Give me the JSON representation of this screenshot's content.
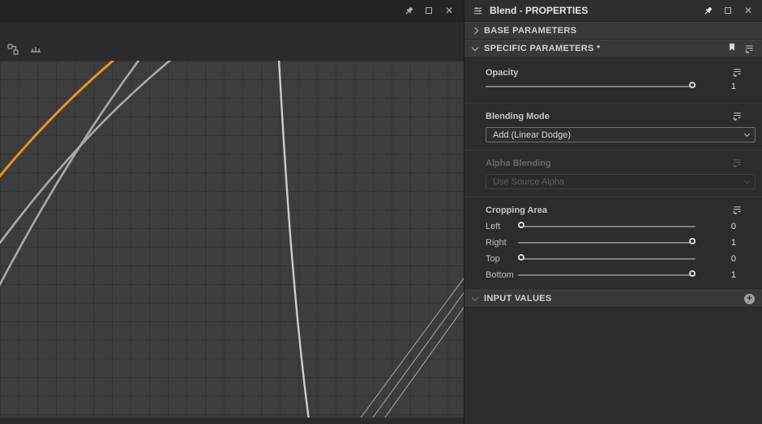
{
  "icons": {
    "close": "✕",
    "add": "+"
  },
  "left_view": {
    "curve_colors": {
      "orange": "#e8941a",
      "gray": "#a9a9a9",
      "light": "#cccccc",
      "thin": "#979797"
    }
  },
  "right_panel": {
    "title": "Blend - PROPERTIES",
    "sections": [
      {
        "label": "BASE PARAMETERS"
      },
      {
        "label": "SPECIFIC PARAMETERS *"
      },
      {
        "label": "INPUT VALUES"
      }
    ],
    "opacity": {
      "label": "Opacity",
      "value": "1"
    },
    "blending_mode": {
      "label": "Blending Mode",
      "selected": "Add (Linear Dodge)"
    },
    "alpha_blending": {
      "label": "Alpha Blending",
      "selected": "Use Source Alpha"
    },
    "cropping": {
      "label": "Cropping Area",
      "rows": [
        {
          "label": "Left",
          "value": "0"
        },
        {
          "label": "Right",
          "value": "1"
        },
        {
          "label": "Top",
          "value": "0"
        },
        {
          "label": "Bottom",
          "value": "1"
        }
      ]
    }
  }
}
